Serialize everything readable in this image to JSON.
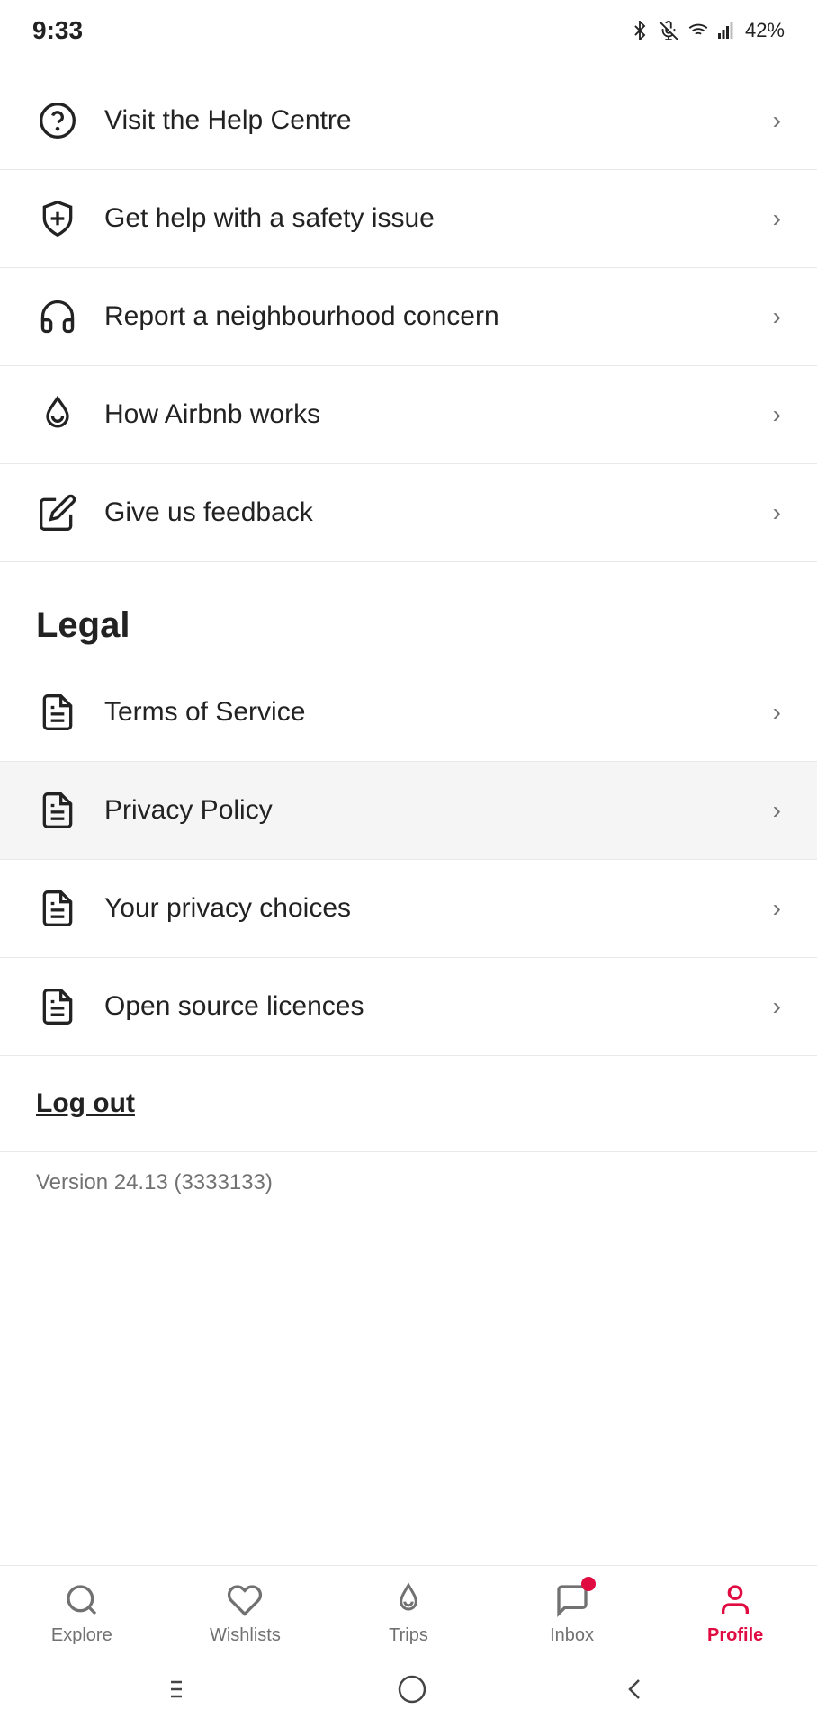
{
  "statusBar": {
    "time": "9:33",
    "battery": "42%"
  },
  "menuItems": [
    {
      "id": "help-centre",
      "label": "Visit the Help Centre",
      "icon": "help-circle"
    },
    {
      "id": "safety-issue",
      "label": "Get help with a safety issue",
      "icon": "shield-plus"
    },
    {
      "id": "neighbourhood-concern",
      "label": "Report a neighbourhood concern",
      "icon": "headset"
    },
    {
      "id": "how-airbnb-works",
      "label": "How Airbnb works",
      "icon": "airbnb"
    },
    {
      "id": "feedback",
      "label": "Give us feedback",
      "icon": "pencil"
    }
  ],
  "legal": {
    "sectionTitle": "Legal",
    "items": [
      {
        "id": "terms-of-service",
        "label": "Terms of Service",
        "icon": "document"
      },
      {
        "id": "privacy-policy",
        "label": "Privacy Policy",
        "icon": "document",
        "highlighted": true
      },
      {
        "id": "privacy-choices",
        "label": "Your privacy choices",
        "icon": "document"
      },
      {
        "id": "open-source",
        "label": "Open source licences",
        "icon": "document"
      }
    ]
  },
  "logoutLabel": "Log out",
  "versionText": "Version 24.13 (3333133)",
  "bottomNav": {
    "tabs": [
      {
        "id": "explore",
        "label": "Explore",
        "icon": "search",
        "active": false
      },
      {
        "id": "wishlists",
        "label": "Wishlists",
        "icon": "heart",
        "active": false
      },
      {
        "id": "trips",
        "label": "Trips",
        "icon": "airbnb-small",
        "active": false
      },
      {
        "id": "inbox",
        "label": "Inbox",
        "icon": "chat",
        "active": false,
        "badge": true
      },
      {
        "id": "profile",
        "label": "Profile",
        "icon": "user",
        "active": true
      }
    ]
  }
}
